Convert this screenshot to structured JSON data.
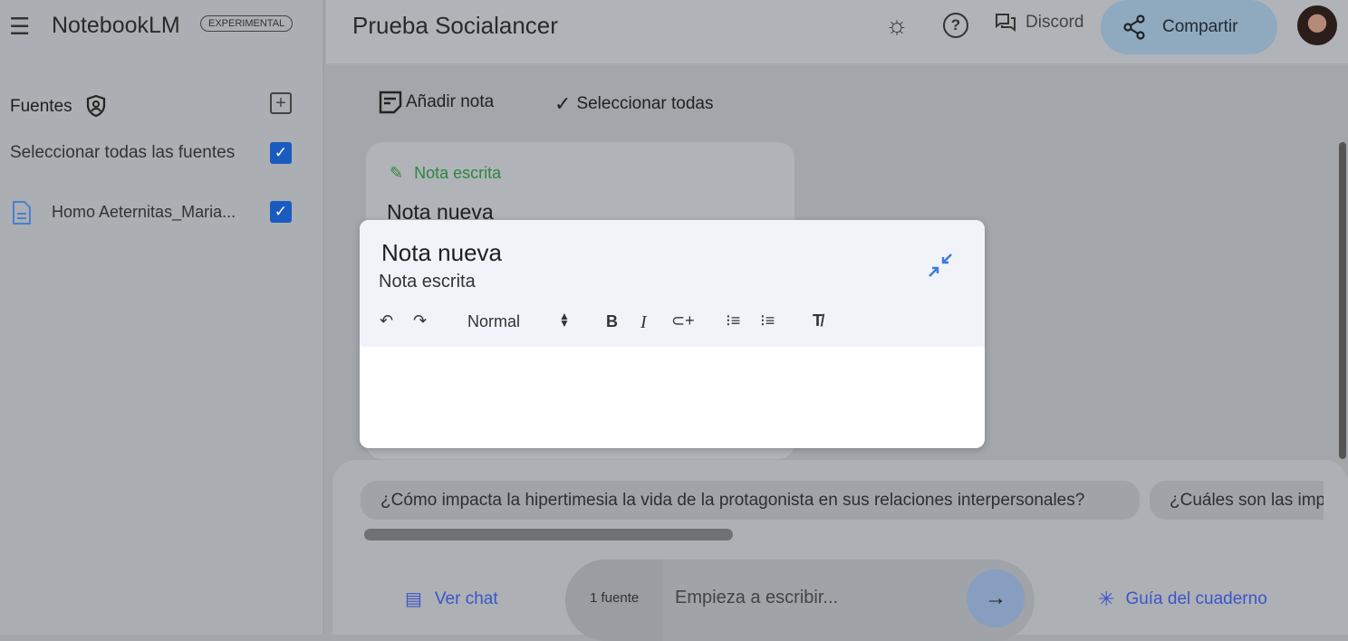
{
  "app": {
    "name": "NotebookLM",
    "badge": "EXPERIMENTAL"
  },
  "header": {
    "notebook_title": "Prueba Socialancer",
    "discord_label": "Discord",
    "share_label": "Compartir"
  },
  "sidebar": {
    "sources_title": "Fuentes",
    "select_all_label": "Seleccionar todas las fuentes",
    "select_all_checked": true,
    "sources": [
      {
        "name": "Homo Aeternitas_Maria...",
        "checked": true
      }
    ]
  },
  "notes_toolbar": {
    "add_note": "Añadir nota",
    "select_all": "Seleccionar todas"
  },
  "note_card": {
    "type": "Nota escrita",
    "title": "Nota nueva"
  },
  "modal": {
    "title": "Nota nueva",
    "subtitle": "Nota escrita",
    "format_select": "Normal",
    "body": ""
  },
  "chat": {
    "suggestions": [
      "¿Cómo impacta la hipertimesia la vida de la protagonista en sus relaciones interpersonales?",
      "¿Cuáles son las imp"
    ],
    "view_chat": "Ver chat",
    "source_count": "1 fuente",
    "input_placeholder": "Empieza a escribir...",
    "notebook_guide": "Guía del cuaderno"
  },
  "colors": {
    "accent_blue": "#3b55c9",
    "green": "#2e8540",
    "checkbox": "#1a5bbf",
    "share_bg": "#8fa9bf"
  }
}
